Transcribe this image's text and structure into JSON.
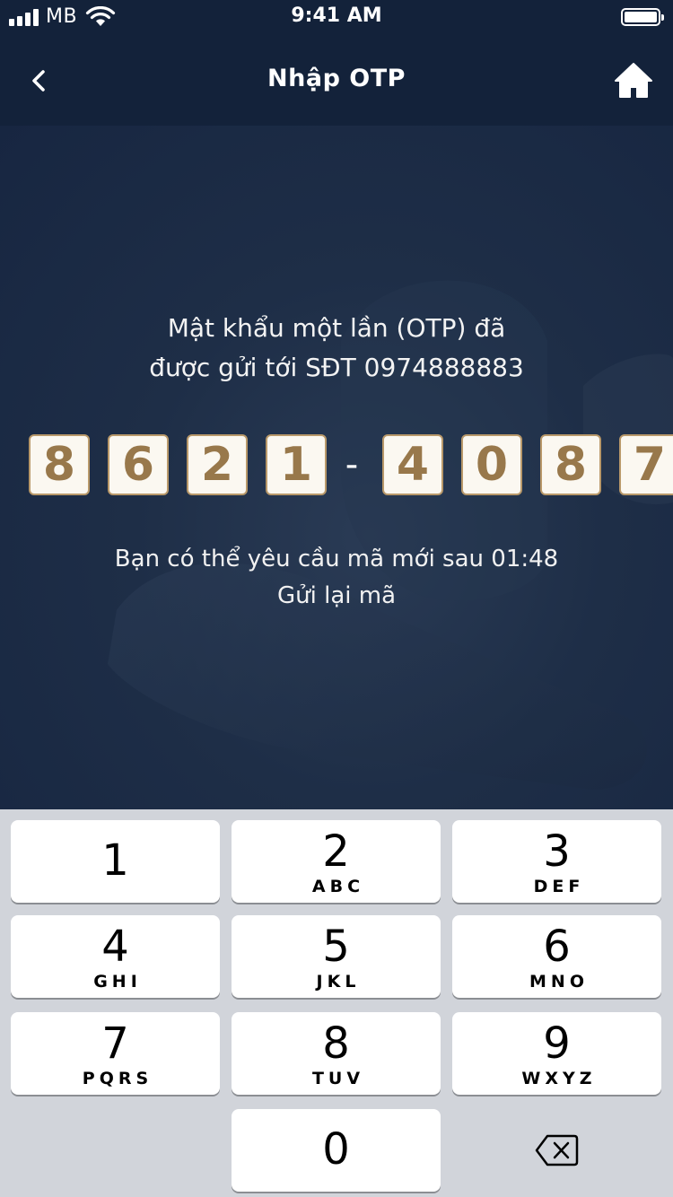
{
  "status_bar": {
    "carrier": "MB",
    "time": "9:41 AM"
  },
  "nav": {
    "title": "Nhập OTP"
  },
  "message": "Mật khẩu một lần (OTP) đã\nđược gửi tới SĐT 0974888883",
  "otp": {
    "digits": [
      "8",
      "6",
      "2",
      "1",
      "4",
      "0",
      "8",
      "7"
    ],
    "separator": "-"
  },
  "resend": {
    "info": "Bạn có thể yêu cầu mã mới sau 01:48",
    "link": "Gửi lại mã"
  },
  "keypad": {
    "keys": [
      {
        "num": "1",
        "letters": ""
      },
      {
        "num": "2",
        "letters": "ABC"
      },
      {
        "num": "3",
        "letters": "DEF"
      },
      {
        "num": "4",
        "letters": "GHI"
      },
      {
        "num": "5",
        "letters": "JKL"
      },
      {
        "num": "6",
        "letters": "MNO"
      },
      {
        "num": "7",
        "letters": "PQRS"
      },
      {
        "num": "8",
        "letters": "TUV"
      },
      {
        "num": "9",
        "letters": "WXYZ"
      },
      {
        "num": "0",
        "letters": ""
      }
    ]
  },
  "icons": {
    "back": "chevron-left-icon",
    "home": "home-icon",
    "backspace": "backspace-icon"
  }
}
